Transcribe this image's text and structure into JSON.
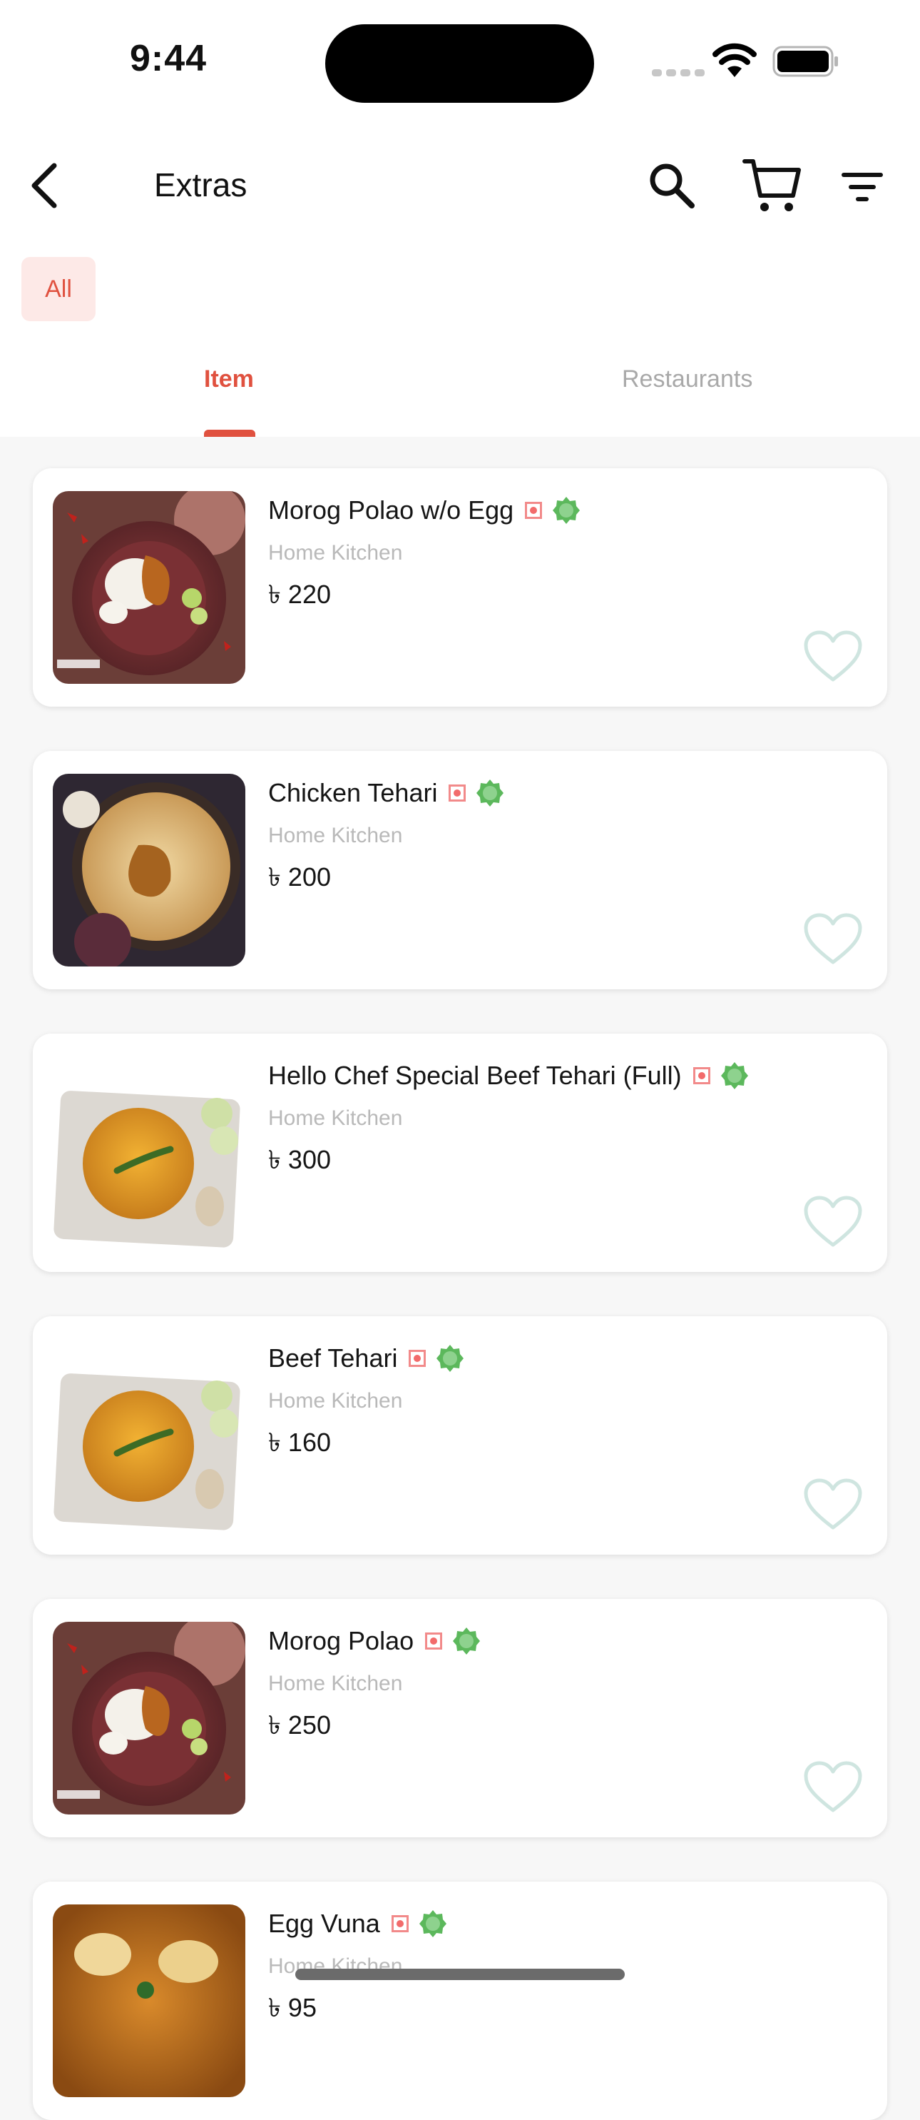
{
  "status": {
    "time": "9:44"
  },
  "header": {
    "title": "Extras"
  },
  "filter_chip": "All",
  "tabs": [
    {
      "label": "Item",
      "active": true
    },
    {
      "label": "Restaurants",
      "active": false
    }
  ],
  "items": [
    {
      "name": "Morog Polao w/o Egg",
      "kitchen": "Home Kitchen",
      "price": "৳ 220",
      "image": "chicken-polao"
    },
    {
      "name": "Chicken Tehari",
      "kitchen": "Home Kitchen",
      "price": "৳ 200",
      "image": "chicken-tehari"
    },
    {
      "name": "Hello Chef Special Beef Tehari (Full)",
      "kitchen": "Home Kitchen",
      "price": "৳ 300",
      "image": "beef-tehari"
    },
    {
      "name": "Beef Tehari",
      "kitchen": "Home Kitchen",
      "price": "৳ 160",
      "image": "beef-tehari"
    },
    {
      "name": "Morog Polao",
      "kitchen": "Home Kitchen",
      "price": "৳ 250",
      "image": "chicken-polao"
    },
    {
      "name": "Egg Vuna",
      "kitchen": "Home Kitchen",
      "price": "৳ 95",
      "image": "egg-vuna"
    }
  ],
  "colors": {
    "accent": "#e0513f",
    "chip_bg": "#fde9e7",
    "heart": "#cfe5e0",
    "veg_mark": "#f26b6b",
    "halal": "#5cb85c"
  }
}
